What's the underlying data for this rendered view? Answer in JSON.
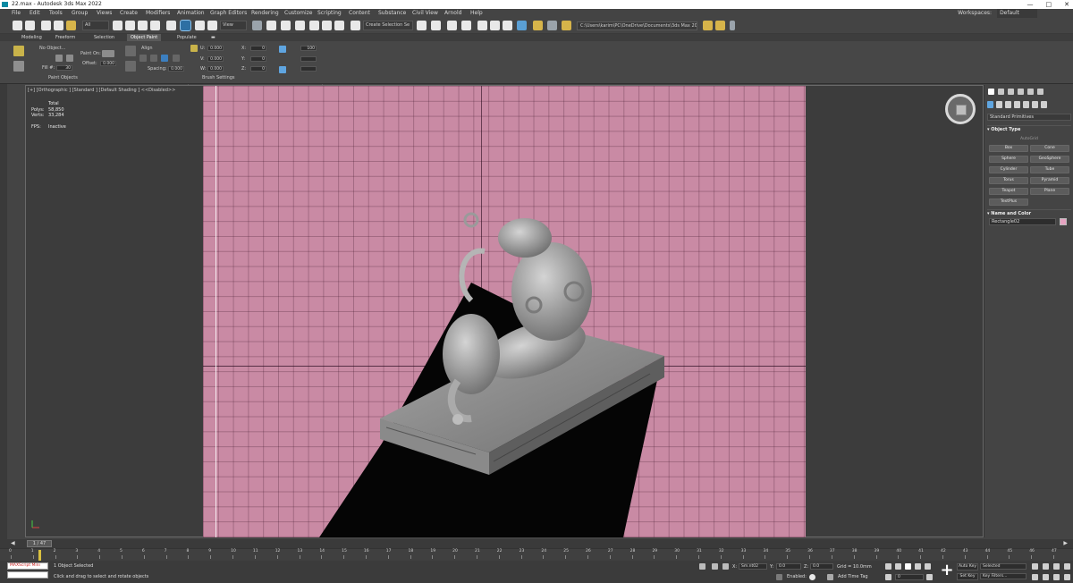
{
  "window": {
    "title": "22.max - Autodesk 3ds Max 2022"
  },
  "menu": [
    "File",
    "Edit",
    "Tools",
    "Group",
    "Views",
    "Create",
    "Modifiers",
    "Animation",
    "Graph Editors",
    "Rendering",
    "Customize",
    "Scripting",
    "Content",
    "Substance",
    "Civil View",
    "Arnold",
    "Help"
  ],
  "workspace": {
    "label": "Workspaces:",
    "value": "Default"
  },
  "toolbar": {
    "filter": "All",
    "refcoord": "View",
    "selection_set": "Create Selection Se",
    "project_path": "C:\\Users\\karim\\PC\\OneDrive\\Documents\\3ds Max 2022"
  },
  "ribbon_tabs": [
    "Modeling",
    "Freeform",
    "Selection",
    "Object Paint",
    "Populate"
  ],
  "ribbon": {
    "no_object": "No Object...",
    "paint_on": "Paint On:",
    "offset_label": "Offset:",
    "offset_value": "0.000",
    "fill_label": "Fill #:",
    "fill_value": "30",
    "align": "Align",
    "spacing_label": "Spacing:",
    "spacing_value": "0.000",
    "u": "U:",
    "v": "V:",
    "w": "W:",
    "u_val": "0.000",
    "v_val": "0.000",
    "w_val": "0.000",
    "x": "X:",
    "y": "Y:",
    "z": "Z:",
    "x_val": "0",
    "y_val": "0",
    "z_val": "0",
    "pct": "100",
    "group_paint": "Paint Objects",
    "group_brush": "Brush Settings"
  },
  "viewport": {
    "label": "[+] [Orthographic ] [Standard ] [Default Shading ]  <<Disabled>>",
    "total": "Total",
    "polys_label": "Polys:",
    "polys": "58,850",
    "verts_label": "Verts:",
    "verts": "33,284",
    "fps_label": "FPS:",
    "fps": "Inactive"
  },
  "command_panel": {
    "category": "Standard Primitives",
    "object_type": "Object Type",
    "autogrid": "AutoGrid",
    "primitives": [
      "Box",
      "Cone",
      "Sphere",
      "GeoSphere",
      "Cylinder",
      "Tube",
      "Torus",
      "Pyramid",
      "Teapot",
      "Plane",
      "TextPlus"
    ],
    "name_and_color": "Name and Color",
    "object_name": "Rectangle02",
    "object_color": "#e6a3c1"
  },
  "timeline": {
    "slider": "1 / 47",
    "ticks": [
      "0",
      "1",
      "2",
      "3",
      "4",
      "5",
      "6",
      "7",
      "8",
      "9",
      "10",
      "11",
      "12",
      "13",
      "14",
      "15",
      "16",
      "17",
      "18",
      "19",
      "20",
      "21",
      "22",
      "23",
      "24",
      "25",
      "26",
      "27",
      "28",
      "29",
      "30",
      "31",
      "32",
      "33",
      "34",
      "35",
      "36",
      "37",
      "38",
      "39",
      "40",
      "41",
      "42",
      "43",
      "44",
      "45",
      "46",
      "47"
    ]
  },
  "status": {
    "maxscript": "MAXScript Mini",
    "selected": "1 Object Selected",
    "prompt": "Click and drag to select and rotate objects",
    "x_label": "X:",
    "x_val": "Sm.nt02",
    "y_label": "Y:",
    "y_val": "0.0",
    "z_label": "Z:",
    "z_val": "0.0",
    "grid": "Grid = 10.0mm",
    "enabled": "Enabled:",
    "add_time_tag": "Add Time Tag",
    "auto_key": "Auto Key",
    "set_key": "Set Key",
    "selected_dd": "Selected",
    "key_filters": "Key Filters...",
    "frame": "0"
  }
}
